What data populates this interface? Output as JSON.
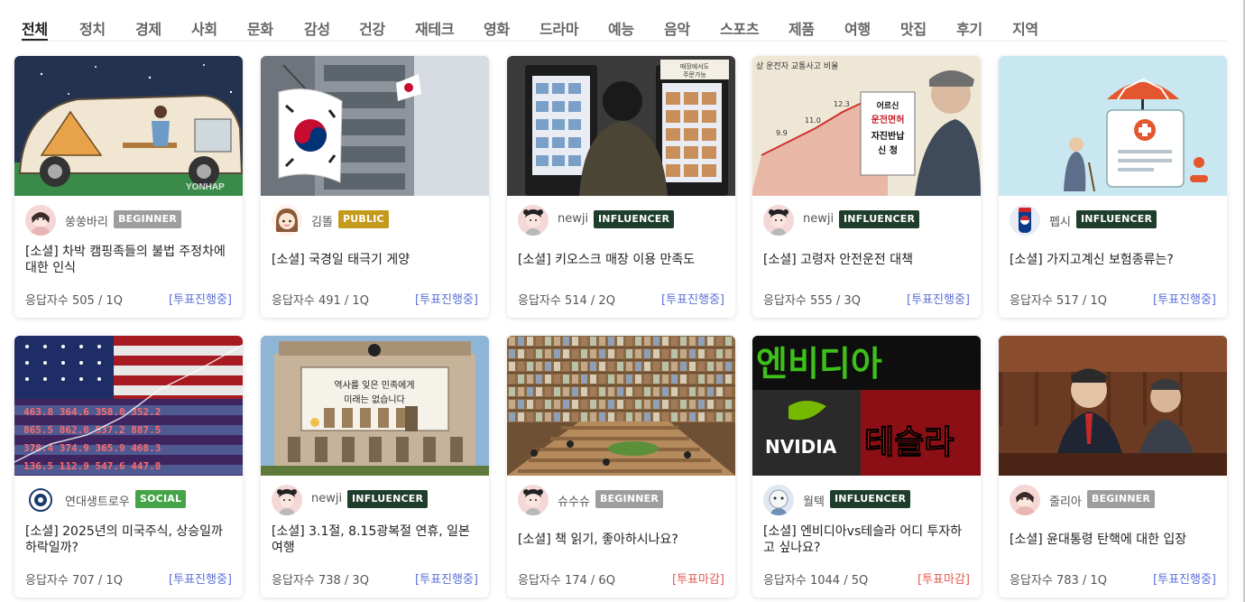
{
  "tabs": [
    "전체",
    "정치",
    "경제",
    "사회",
    "문화",
    "감성",
    "건강",
    "재테크",
    "영화",
    "드라마",
    "예능",
    "음악",
    "스포츠",
    "제품",
    "여행",
    "맛집",
    "후기",
    "지역"
  ],
  "active_tab": "전체",
  "colors": {
    "BEGINNER": "#9e9e9e",
    "PUBLIC": "#c49a1c",
    "INFLUENCER": "#1f3d2b",
    "SOCIAL": "#45a447",
    "status_ongoing": "#5b6fd6",
    "status_closed": "#e05a4f"
  },
  "cards": [
    {
      "author": "쑹쑹바리",
      "badge": "BEGINNER",
      "title": "[소셜] 차박 캠핑족들의 불법 주정차에 대한 인식",
      "meta": "응답자수 505 / 1Q",
      "status": "[투표진행중]",
      "thumb": "camping",
      "thumb_text": "YONHAP",
      "avatar": "girl-pink"
    },
    {
      "author": "김똘",
      "badge": "PUBLIC",
      "title": "[소셜] 국경일 태극기 게양",
      "meta": "응답자수 491 / 1Q",
      "status": "[투표진행중]",
      "thumb": "flag",
      "thumb_text": "",
      "avatar": "girl-cartoon"
    },
    {
      "author": "newji",
      "badge": "INFLUENCER",
      "title": "[소셜] 키오스크 매장 이용 만족도",
      "meta": "응답자수 514 / 2Q",
      "status": "[투표진행중]",
      "thumb": "kiosk",
      "thumb_text": "매장에서도 주문가능",
      "avatar": "girl-dark"
    },
    {
      "author": "newji",
      "badge": "INFLUENCER",
      "title": "[소셜] 고령자 안전운전 대책",
      "meta": "응답자수 555 / 3Q",
      "status": "[투표진행중]",
      "thumb": "elderly",
      "thumb_text": "운전면허 자진반납 신청",
      "avatar": "girl-dark"
    },
    {
      "author": "펩시",
      "badge": "INFLUENCER",
      "title": "[소셜] 가지고계신 보험종류는?",
      "meta": "응답자수 517 / 1Q",
      "status": "[투표진행중]",
      "thumb": "insurance",
      "thumb_text": "",
      "avatar": "pepsi"
    },
    {
      "author": "연대생트로우",
      "badge": "SOCIAL",
      "title": "[소셜] 2025년의 미국주식, 상승일까 하락일까?",
      "meta": "응답자수 707 / 1Q",
      "status": "[투표진행중]",
      "thumb": "usflag",
      "thumb_text": "",
      "avatar": "emblem"
    },
    {
      "author": "newji",
      "badge": "INFLUENCER",
      "title": "[소셜] 3.1절, 8.15광복절 연휴, 일본 여행",
      "meta": "응답자수 738 / 3Q",
      "status": "[투표진행중]",
      "thumb": "cityhall",
      "thumb_text": "역사를 잊은 민족에게 미래는 없습니다",
      "avatar": "girl-dark"
    },
    {
      "author": "슈수슈",
      "badge": "BEGINNER",
      "title": "[소셜] 책 읽기, 좋아하시나요?",
      "meta": "응답자수 174 / 6Q",
      "status": "[투표마감]",
      "thumb": "library",
      "thumb_text": "",
      "avatar": "girl-dark"
    },
    {
      "author": "월텍",
      "badge": "INFLUENCER",
      "title": "[소셜] 엔비디아vs테슬라 어디 투자하고 싶나요?",
      "meta": "응답자수 1044 / 5Q",
      "status": "[투표마감]",
      "thumb": "nvidia",
      "thumb_text_a": "엔비디아",
      "thumb_text_b": "테슬라",
      "thumb_text": "NVIDIA",
      "avatar": "blue-cartoon"
    },
    {
      "author": "줄리아",
      "badge": "BEGINNER",
      "title": "[소셜] 윤대통령 탄핵에 대한 입장",
      "meta": "응답자수 783 / 1Q",
      "status": "[투표진행중]",
      "thumb": "court",
      "thumb_text": "",
      "avatar": "girl-pink"
    }
  ]
}
